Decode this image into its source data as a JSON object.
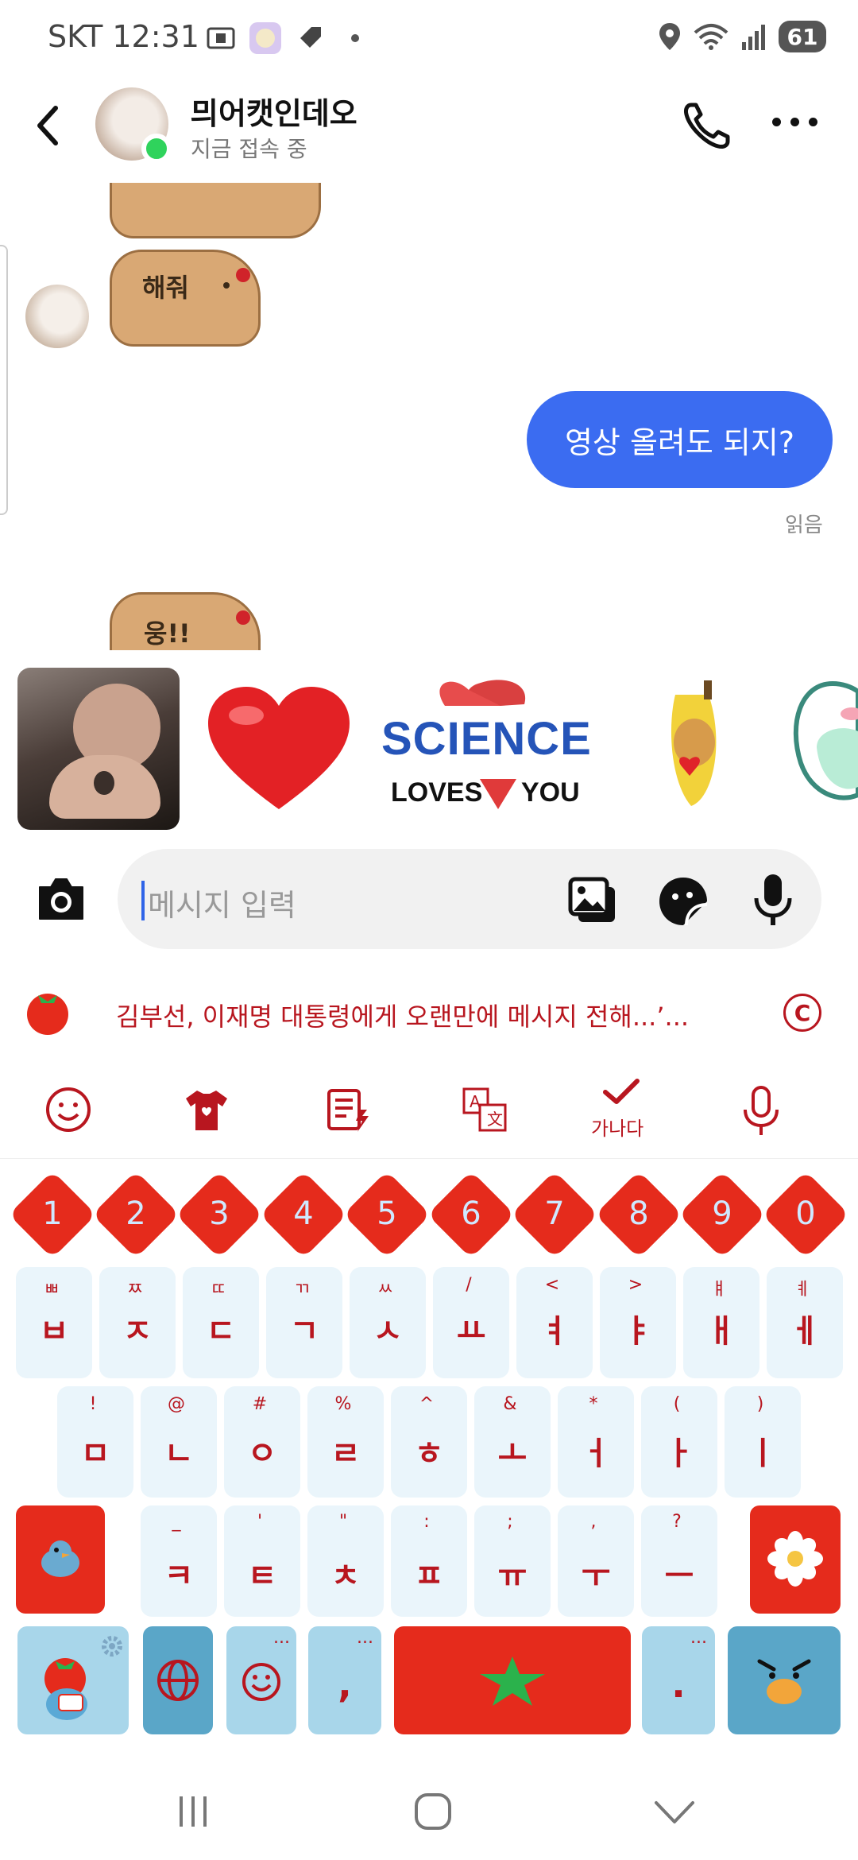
{
  "status_bar": {
    "carrier_time": "SKT 12:31",
    "battery": "61"
  },
  "header": {
    "contact_name": "믜어캣인데오",
    "presence": "지금 접속 중"
  },
  "chat": {
    "sticker_text_top": "해줘",
    "sticker_text_bottom": "웅!!",
    "outgoing_message": "영상 올려도 되지?",
    "read_receipt": "읽음"
  },
  "sticker_strip": {
    "science_word": "SCIENCE",
    "loves_word": "LOVES",
    "you_word": "YOU"
  },
  "composer": {
    "placeholder": "메시지 입력"
  },
  "keyboard": {
    "news_headline": "김부선, 이재명 대통령에게 오랜만에 메시지 전해...’...",
    "news_badge": "C",
    "spell_label": "가나다",
    "number_row": [
      "1",
      "2",
      "3",
      "4",
      "5",
      "6",
      "7",
      "8",
      "9",
      "0"
    ],
    "row1": [
      {
        "main": "ㅂ",
        "sub": "ㅃ"
      },
      {
        "main": "ㅈ",
        "sub": "ㅉ"
      },
      {
        "main": "ㄷ",
        "sub": "ㄸ"
      },
      {
        "main": "ㄱ",
        "sub": "ㄲ"
      },
      {
        "main": "ㅅ",
        "sub": "ㅆ"
      },
      {
        "main": "ㅛ",
        "sub": "/"
      },
      {
        "main": "ㅕ",
        "sub": "<"
      },
      {
        "main": "ㅑ",
        "sub": ">"
      },
      {
        "main": "ㅐ",
        "sub": "ㅒ"
      },
      {
        "main": "ㅔ",
        "sub": "ㅖ"
      }
    ],
    "row2": [
      {
        "main": "ㅁ",
        "sub": "!"
      },
      {
        "main": "ㄴ",
        "sub": "@"
      },
      {
        "main": "ㅇ",
        "sub": "#"
      },
      {
        "main": "ㄹ",
        "sub": "%"
      },
      {
        "main": "ㅎ",
        "sub": "^"
      },
      {
        "main": "ㅗ",
        "sub": "&"
      },
      {
        "main": "ㅓ",
        "sub": "*"
      },
      {
        "main": "ㅏ",
        "sub": "("
      },
      {
        "main": "ㅣ",
        "sub": ")"
      }
    ],
    "row3": [
      {
        "main": "ㅋ",
        "sub": "_"
      },
      {
        "main": "ㅌ",
        "sub": "'"
      },
      {
        "main": "ㅊ",
        "sub": "\""
      },
      {
        "main": "ㅍ",
        "sub": ":"
      },
      {
        "main": "ㅠ",
        "sub": ";"
      },
      {
        "main": "ㅜ",
        "sub": ","
      },
      {
        "main": "ㅡ",
        "sub": "?"
      }
    ],
    "comma_key": ",",
    "period_key": ".",
    "ellipsis": "..."
  },
  "colors": {
    "accent_blue": "#3b6cf1",
    "keyboard_red": "#e52b1c",
    "key_text": "#b8161f",
    "key_bg": "#eaf5fb",
    "online": "#2fd35c"
  }
}
